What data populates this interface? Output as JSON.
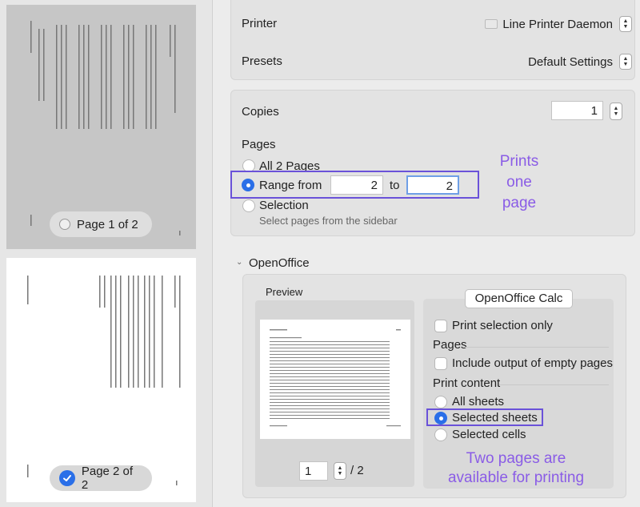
{
  "sidebar": {
    "pages": [
      {
        "label": "Page 1 of 2",
        "selected": false
      },
      {
        "label": "Page 2 of 2",
        "selected": true
      }
    ]
  },
  "printer": {
    "label": "Printer",
    "value": "Line Printer Daemon"
  },
  "presets": {
    "label": "Presets",
    "value": "Default Settings"
  },
  "copies": {
    "label": "Copies",
    "value": "1"
  },
  "pages": {
    "label": "Pages",
    "all_label": "All 2 Pages",
    "range_label": "Range from",
    "range_from": "2",
    "range_to_label": "to",
    "range_to": "2",
    "selection_label": "Selection",
    "selection_hint": "Select pages from the sidebar"
  },
  "annotation_top": "Prints\none\npage",
  "openoffice": {
    "section_label": "OpenOffice",
    "preview_label": "Preview",
    "preview_page_value": "1",
    "preview_page_total": "/ 2",
    "app_button": "OpenOffice Calc",
    "print_selection_only": "Print selection only",
    "pages_label": "Pages",
    "include_empty": "Include output of empty pages",
    "print_content_label": "Print content",
    "all_sheets": "All sheets",
    "selected_sheets": "Selected sheets",
    "selected_cells": "Selected cells"
  },
  "annotation_bottom": "Two pages are\navailable for printing",
  "colors": {
    "accent": "#2a6fe8",
    "annotation": "#8a5ce6",
    "highlight_box": "#6a52d9"
  }
}
